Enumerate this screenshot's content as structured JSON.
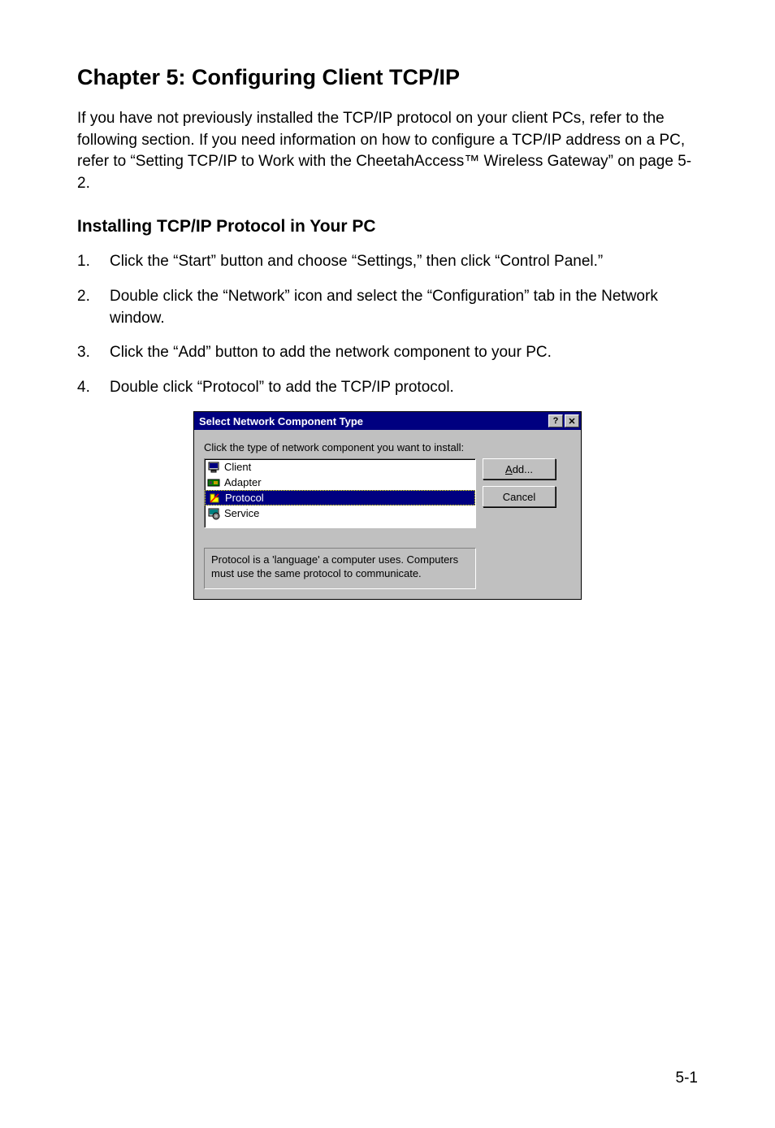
{
  "chapter": {
    "title": "Chapter 5: Configuring Client TCP/IP",
    "intro": "If you have not previously installed the TCP/IP protocol on your client PCs, refer to the following section. If you need information on how to configure a TCP/IP address on a PC, refer to “Setting TCP/IP to Work with the CheetahAccess™ Wireless Gateway” on page 5-2."
  },
  "section": {
    "title": "Installing TCP/IP Protocol in Your PC",
    "steps": [
      {
        "num": "1.",
        "text": "Click the “Start” button and choose “Settings,” then click “Control Panel.”"
      },
      {
        "num": "2.",
        "text": "Double click the “Network” icon and select the “Configuration” tab in the Network window."
      },
      {
        "num": "3.",
        "text": "Click the “Add” button to add the network component to your PC."
      },
      {
        "num": "4.",
        "text": "Double click “Protocol” to add the TCP/IP protocol."
      }
    ]
  },
  "dialog": {
    "title": "Select Network Component Type",
    "help_glyph": "?",
    "close_glyph": "✕",
    "instruction": "Click the type of network component you want to install:",
    "items": [
      {
        "label": "Client",
        "selected": false,
        "icon": "client-icon"
      },
      {
        "label": "Adapter",
        "selected": false,
        "icon": "adapter-icon"
      },
      {
        "label": "Protocol",
        "selected": true,
        "icon": "protocol-icon"
      },
      {
        "label": "Service",
        "selected": false,
        "icon": "service-icon"
      }
    ],
    "buttons": {
      "add_prefix": "A",
      "add_suffix": "dd...",
      "cancel": "Cancel"
    },
    "description": "Protocol is a 'language' a computer uses. Computers must use the same protocol to communicate."
  },
  "page_number": "5-1"
}
